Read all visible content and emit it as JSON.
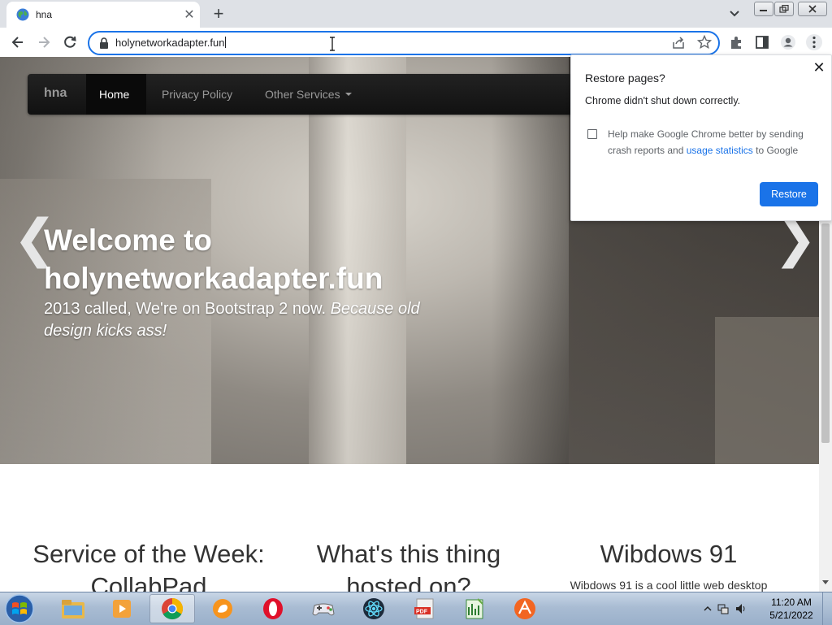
{
  "browser": {
    "tab_title": "hna",
    "url": "holynetworkadapter.fun"
  },
  "site": {
    "brand": "hna",
    "nav": {
      "home": "Home",
      "privacy": "Privacy Policy",
      "other": "Other Services"
    },
    "hero": {
      "title": "Welcome to holynetworkadapter.fun",
      "subtitle_plain": "2013 called, We're on Bootstrap 2 now.",
      "subtitle_emph": "Because old design kicks ass!",
      "prev": "❮",
      "next": "❯"
    },
    "columns": [
      {
        "heading": "Service of the Week: CollabPad"
      },
      {
        "heading": "What's this thing hosted on?"
      },
      {
        "heading": "Wibdows 91",
        "text": "Wibdows 91 is a cool little web desktop"
      }
    ]
  },
  "restore_popup": {
    "title": "Restore pages?",
    "message": "Chrome didn't shut down correctly.",
    "checkbox_text_1": "Help make Google Chrome better by sending crash reports and",
    "checkbox_link": "usage statistics",
    "checkbox_text_2": "to Google",
    "restore_button": "Restore"
  },
  "taskbar": {
    "time": "11:20 AM",
    "date": "5/21/2022"
  },
  "colors": {
    "accent": "#1a73e8",
    "navbar": "#111111"
  }
}
